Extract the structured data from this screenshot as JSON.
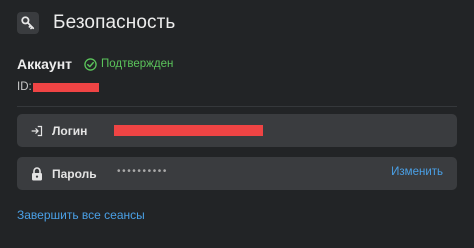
{
  "header": {
    "title": "Безопасность",
    "icon": "key-icon"
  },
  "account": {
    "label": "Аккаунт",
    "status_text": "Подтвержден",
    "status_icon": "check-circle-icon",
    "status_color": "#5bc45b",
    "id_label": "ID:"
  },
  "fields": {
    "login": {
      "label": "Логин",
      "icon": "login-icon"
    },
    "password": {
      "label": "Пароль",
      "icon": "lock-icon",
      "masked_value": "••••••••••",
      "action_label": "Изменить"
    }
  },
  "actions": {
    "end_all_sessions": "Завершить все сеансы"
  },
  "colors": {
    "background": "#222426",
    "field_background": "#3a3c3f",
    "link": "#4aa0e6",
    "redaction": "#ef4444"
  }
}
